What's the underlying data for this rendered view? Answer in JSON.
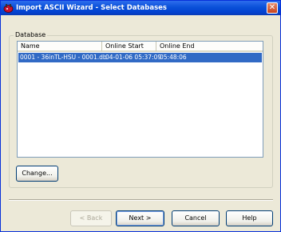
{
  "window": {
    "title": "Import ASCII Wizard - Select Databases",
    "close_glyph": "✕",
    "icon": "app-icon"
  },
  "group": {
    "label": "Database"
  },
  "list": {
    "columns": [
      "Name",
      "Online Start",
      "Online End"
    ],
    "rows": [
      {
        "name": "0001 - 36inTL-HSU - 0001.db",
        "online_start": "04-01-06 05:37:09",
        "online_end": "05:48:06",
        "selected": true
      }
    ]
  },
  "buttons": {
    "change": "Change...",
    "back": "< Back",
    "next": "Next >",
    "cancel": "Cancel",
    "help": "Help"
  },
  "colors": {
    "titlebar": "#0a50d8",
    "selection": "#316ac5",
    "face": "#ece9d8"
  }
}
